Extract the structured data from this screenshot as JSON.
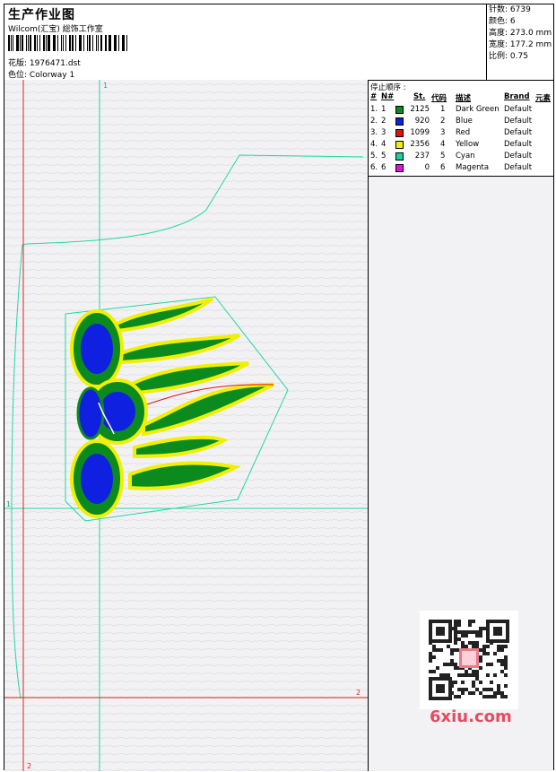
{
  "header": {
    "title": "生产作业图",
    "company": "Wilcom(汇宝) 総饰工作室",
    "design_label": "花版:",
    "design_value": "1976471.dst",
    "colorway_label": "色位:",
    "colorway_value": "Colorway 1"
  },
  "stats": {
    "stitches_label": "针数:",
    "stitches_value": "6739",
    "colors_label": "颜色:",
    "colors_value": "6",
    "height_label": "高度:",
    "height_value": "273.0 mm",
    "width_label": "宽度:",
    "width_value": "177.2 mm",
    "scale_label": "比例:",
    "scale_value": "0.75"
  },
  "stop_sequence": {
    "title": "停止顺序 :",
    "headers": {
      "num": "#",
      "n": "N#",
      "st": "St.",
      "code": "代码",
      "desc": "描述",
      "brand": "Brand",
      "element": "元素"
    },
    "rows": [
      {
        "num": "1.",
        "n": "1",
        "st": "2125",
        "code": "1",
        "desc": "Dark Green",
        "brand": "Default",
        "color": "#0b8a1e"
      },
      {
        "num": "2.",
        "n": "2",
        "st": "920",
        "code": "2",
        "desc": "Blue",
        "brand": "Default",
        "color": "#1020e0"
      },
      {
        "num": "3.",
        "n": "3",
        "st": "1099",
        "code": "3",
        "desc": "Red",
        "brand": "Default",
        "color": "#e01010"
      },
      {
        "num": "4.",
        "n": "4",
        "st": "2356",
        "code": "4",
        "desc": "Yellow",
        "brand": "Default",
        "color": "#f0f000"
      },
      {
        "num": "5.",
        "n": "5",
        "st": "237",
        "code": "5",
        "desc": "Cyan",
        "brand": "Default",
        "color": "#20d0a0"
      },
      {
        "num": "6.",
        "n": "6",
        "st": "0",
        "code": "6",
        "desc": "Magenta",
        "brand": "Default",
        "color": "#e010e0"
      }
    ]
  },
  "canvas": {
    "guide_label_top": "1",
    "guide_label_right": "2",
    "guide_label_bottom": "2",
    "guide_label_left": "1"
  },
  "watermark": {
    "site": "6xiu.com"
  }
}
